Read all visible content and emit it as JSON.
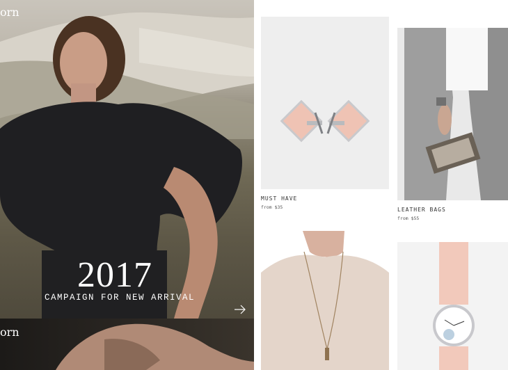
{
  "hero": {
    "brand": "orn",
    "year": "2017",
    "subtitle": "CAMPAIGN FOR NEW ARRIVAL"
  },
  "tile2": {
    "brand": "orn"
  },
  "products": [
    {
      "name": "MUST HAVE",
      "price": "from $35",
      "image": "rose-gold-cufflinks"
    },
    {
      "name": "LEATHER BAGS",
      "price": "from $55",
      "image": "woman-with-clutch"
    },
    {
      "name": "",
      "price": "",
      "image": "beige-top-with-necklace"
    },
    {
      "name": "",
      "price": "",
      "image": "pink-strap-watch"
    }
  ],
  "icons": {
    "arrow": "arrow-right-icon"
  }
}
